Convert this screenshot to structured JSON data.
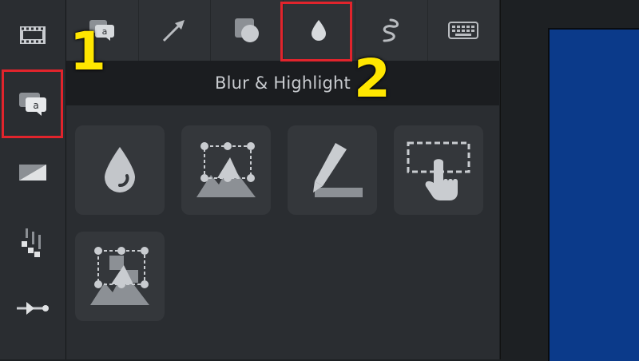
{
  "panel": {
    "title": "Blur & Highlight"
  },
  "annotations": {
    "callout_1": "1",
    "callout_2": "2"
  },
  "left_rail": {
    "items": [
      {
        "icon": "film-icon"
      },
      {
        "icon": "annotations-icon"
      },
      {
        "icon": "transitions-icon"
      },
      {
        "icon": "behaviors-icon"
      },
      {
        "icon": "animations-icon"
      }
    ]
  },
  "top_tabs": {
    "items": [
      {
        "icon": "callout-icon"
      },
      {
        "icon": "arrow-icon"
      },
      {
        "icon": "shape-icon"
      },
      {
        "icon": "blur-drop-icon"
      },
      {
        "icon": "sketch-motion-icon"
      },
      {
        "icon": "keyboard-icon"
      }
    ]
  },
  "tiles": {
    "items": [
      {
        "icon": "blur-tool-icon"
      },
      {
        "icon": "pixelate-tool-icon"
      },
      {
        "icon": "highlight-tool-icon"
      },
      {
        "icon": "interactive-hotspot-icon"
      },
      {
        "icon": "spotlight-tool-icon"
      }
    ]
  },
  "colors": {
    "highlight_red": "#e1242c",
    "callout_yellow": "#ffe600",
    "canvas_blue": "#0b3a8a",
    "icon_gray": "#b9bcc0"
  }
}
